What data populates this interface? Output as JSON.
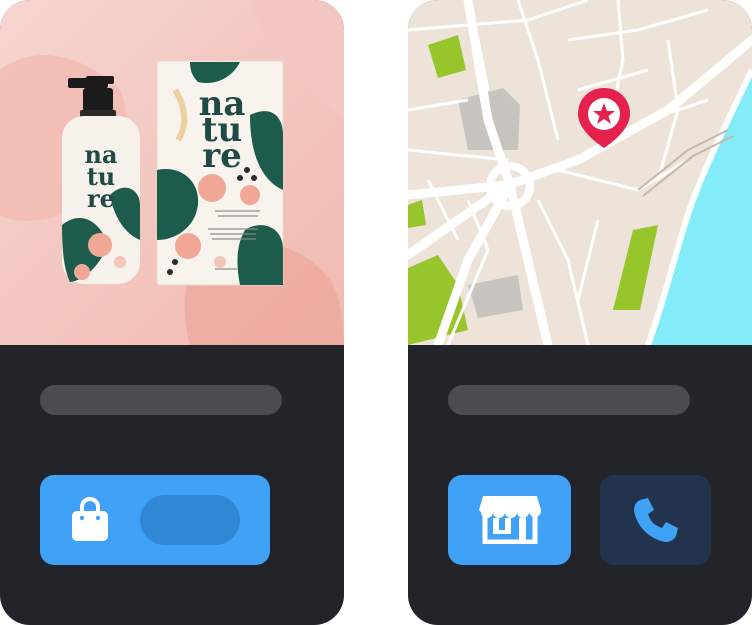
{
  "product_card": {
    "bottle_brand": [
      "na",
      "tu",
      "re"
    ],
    "box_brand": [
      "na",
      "tu",
      "re"
    ],
    "buy_button_icon": "shopping-bag-icon"
  },
  "map_card": {
    "pin_icon": "star-location-pin-icon",
    "store_button_icon": "storefront-icon",
    "call_button_icon": "phone-icon"
  },
  "colors": {
    "card_bg": "#232429",
    "skeleton": "#4b4c51",
    "accent_blue": "#3fa2f7",
    "accent_blue_dark": "#2f87d6",
    "call_bg": "#22344d",
    "map_water": "#84ecf9",
    "map_park": "#97c52c",
    "map_pin": "#e5214d",
    "product_bg": "#f2c5bd"
  }
}
